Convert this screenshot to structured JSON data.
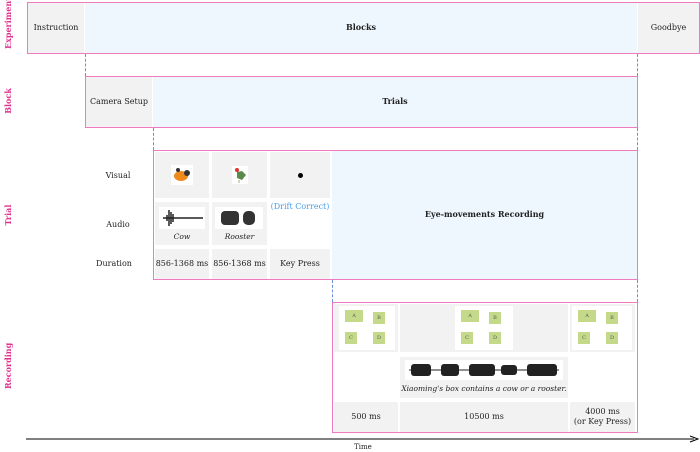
{
  "row_labels": {
    "experiment": "Experiment",
    "block": "Block",
    "trial": "Trial",
    "recording": "Recording"
  },
  "experiment": {
    "instruction": "Instruction",
    "blocks": "Blocks",
    "goodbye": "Goodbye"
  },
  "block": {
    "camera_setup": "Camera Setup",
    "trials": "Trials"
  },
  "trial": {
    "labels": {
      "visual": "Visual",
      "audio": "Audio",
      "duration": "Duration"
    },
    "visual": [
      {
        "icon": "cow-image"
      },
      {
        "icon": "rooster-image"
      },
      {
        "icon": "fixation-dot"
      }
    ],
    "drift_correct": "(Drift Correct)",
    "audio": [
      {
        "caption": "Cow"
      },
      {
        "caption": "Rooster"
      }
    ],
    "durations": [
      "856-1368 ms",
      "856-1368 ms",
      "Key Press"
    ],
    "recording": "Eye-movements Recording"
  },
  "recording": {
    "sentence": "Xiaoming's box contains a cow or a rooster.",
    "box_labels": [
      "A",
      "B",
      "C",
      "D"
    ],
    "durations": [
      "500 ms",
      "10500 ms",
      "4000 ms",
      "(or Key Press)"
    ]
  },
  "axis": {
    "label": "Time"
  },
  "colors": {
    "border": "#f07ac0",
    "label": "#e0338f",
    "highlight": "#eef6fe",
    "cell": "#f2f2f2",
    "drift": "#4a9fe8"
  }
}
